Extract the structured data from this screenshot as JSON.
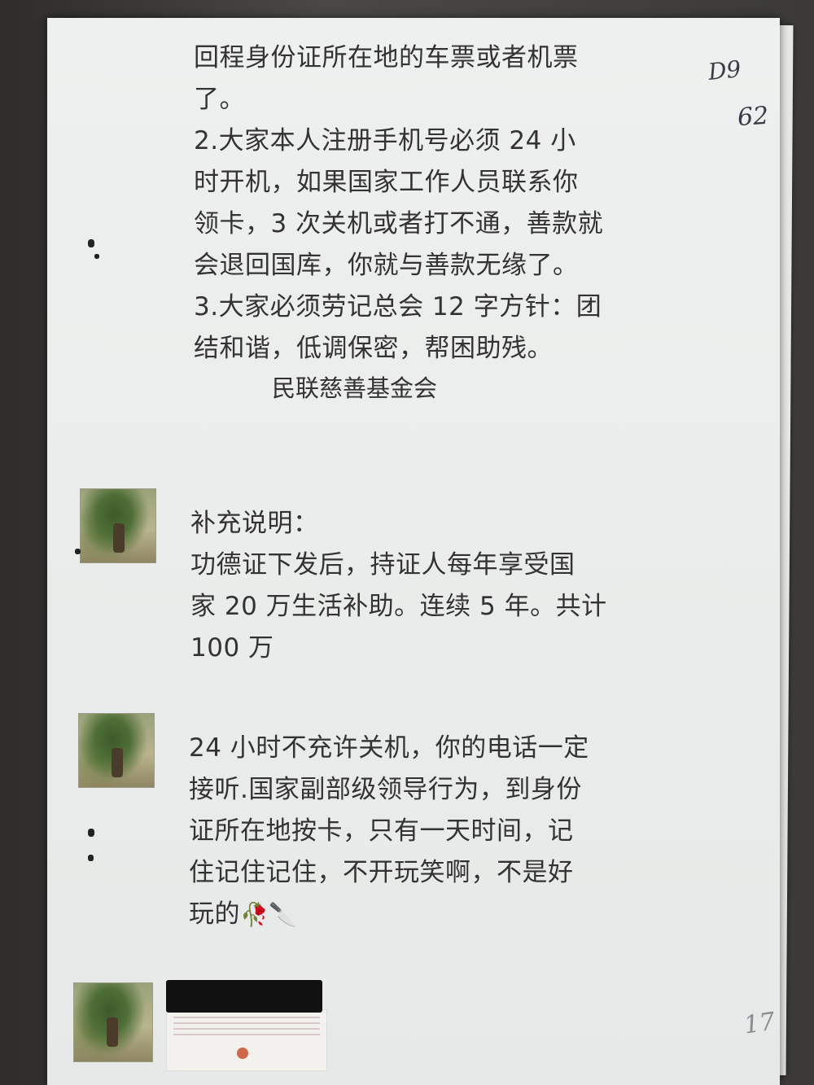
{
  "message1": {
    "lines": [
      "回程身份证所在地的车票或者机票",
      "了。",
      "2.大家本人注册手机号必须 24 小",
      "时开机，如果国家工作人员联系你",
      "领卡，3 次关机或者打不通，善款就",
      "会退回国库，你就与善款无缘了。",
      "3.大家必须劳记总会 12 字方针：团",
      "结和谐，低调保密，帮困助残。"
    ],
    "signature": "民联慈善基金会"
  },
  "message2": {
    "lines": [
      "补充说明：",
      "功德证下发后，持证人每年享受国",
      "家 20 万生活补助。连续 5 年。共计",
      "100 万"
    ]
  },
  "message3": {
    "lines": [
      "24 小时不充许关机，你的电话一定",
      "接听.国家副部级领导行为，到身份",
      "证所在地按卡，只有一天时间，记",
      "住记住记住，不开玩笑啊，不是好",
      "玩的"
    ],
    "emojis": "🥀🔪"
  },
  "annotations": {
    "top_mark": "D9",
    "page_mark": "62",
    "bottom_mark": "17"
  },
  "icons": {
    "avatar": "bonsai-tree-avatar-icon"
  }
}
